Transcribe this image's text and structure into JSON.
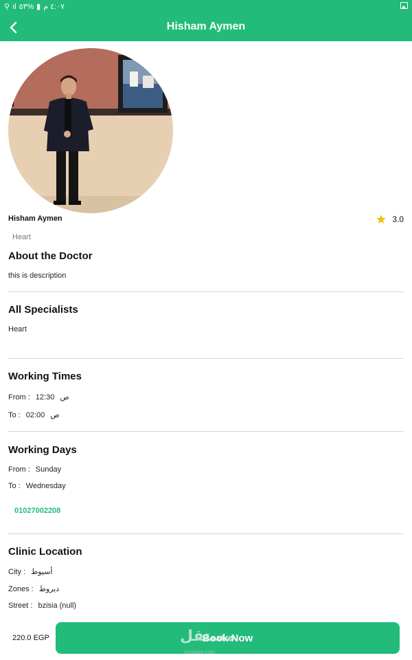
{
  "status_bar": {
    "time": "٤:٠٧ م",
    "battery": "%٥٣"
  },
  "header": {
    "title": "Hisham Aymen"
  },
  "doctor": {
    "name": "Hisham Aymen",
    "rating": "3.0",
    "specialty_tag": "Heart"
  },
  "about": {
    "title": "About the Doctor",
    "description": "this is description"
  },
  "specialists": {
    "title": "All Specialists",
    "items": [
      "Heart"
    ]
  },
  "working_times": {
    "title": "Working Times",
    "from_label": "From :",
    "from_value": "12:30",
    "from_suffix": "ص",
    "to_label": "To :",
    "to_value": "02:00",
    "to_suffix": "ص"
  },
  "working_days": {
    "title": "Working Days",
    "from_label": "From :",
    "from_value": "Sunday",
    "to_label": "To :",
    "to_value": "Wednesday",
    "phone": "01027002208"
  },
  "clinic_location": {
    "title": "Clinic Location",
    "city_label": "City :",
    "city_value": "أسيوط",
    "zones_label": "Zones :",
    "zones_value": "ديروط",
    "street_label": "Street :",
    "street_value": "bzisia (null)"
  },
  "footer": {
    "price": "220.0 EGP",
    "book_label": "Book Now",
    "watermark": "مستقل",
    "watermark_sub": "mostaql.com"
  },
  "colors": {
    "primary": "#22bb7a",
    "star": "#f1c40f"
  }
}
